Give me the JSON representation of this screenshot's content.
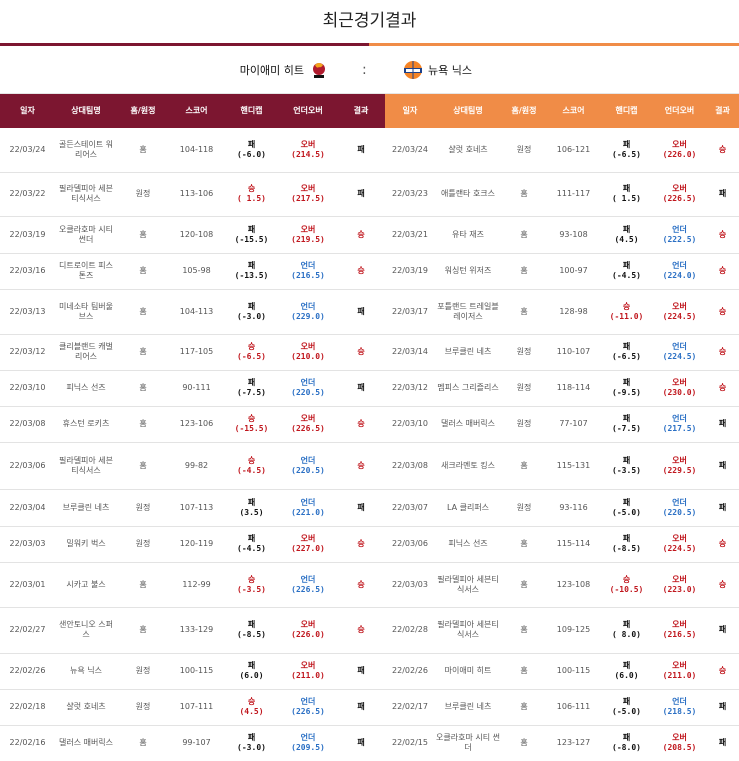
{
  "title": "최근경기결과",
  "left_team": "마이애미 히트",
  "right_team": "뉴욕 닉스",
  "vs": ":",
  "colors": {
    "left_header": "#7c1630",
    "right_header": "#f08c47",
    "win": "#c0161d",
    "under": "#2a6fc4"
  },
  "left_headers": [
    "일자",
    "상대팀명",
    "홈/원정",
    "스코어",
    "핸디캡",
    "언더오버",
    "결과"
  ],
  "right_headers": [
    "일자",
    "상대팀명",
    "홈/원정",
    "스코어",
    "핸디캡",
    "언더오버",
    "결과"
  ],
  "rows": [
    {
      "left": {
        "date": "22/03/24",
        "opp": "골든스테이트 워리어스",
        "ha": "홈",
        "score": "104-118",
        "hc1": "패",
        "hc2": "(-6.0)",
        "hc_win": false,
        "ou1": "오버",
        "ou2": "(214.5)",
        "ou_over": true,
        "res": "패",
        "res_win": false
      },
      "right": {
        "date": "22/03/24",
        "opp": "샬럿 호네츠",
        "ha": "원정",
        "score": "106-121",
        "hc1": "패",
        "hc2": "(-6.5)",
        "hc_win": false,
        "ou1": "오버",
        "ou2": "(226.0)",
        "ou_over": true,
        "res": "승",
        "res_win": true
      }
    },
    {
      "left": {
        "date": "22/03/22",
        "opp": "필라델피아 세븐티식서스",
        "ha": "원정",
        "score": "113-106",
        "hc1": "승",
        "hc2": "( 1.5)",
        "hc_win": true,
        "ou1": "오버",
        "ou2": "(217.5)",
        "ou_over": true,
        "res": "패",
        "res_win": false
      },
      "right": {
        "date": "22/03/23",
        "opp": "애틀랜타 호크스",
        "ha": "홈",
        "score": "111-117",
        "hc1": "패",
        "hc2": "( 1.5)",
        "hc_win": false,
        "ou1": "오버",
        "ou2": "(226.5)",
        "ou_over": true,
        "res": "패",
        "res_win": false
      }
    },
    {
      "left": {
        "date": "22/03/19",
        "opp": "오클라호마 시티 썬더",
        "ha": "홈",
        "score": "120-108",
        "hc1": "패",
        "hc2": "(-15.5)",
        "hc_win": false,
        "ou1": "오버",
        "ou2": "(219.5)",
        "ou_over": true,
        "res": "승",
        "res_win": true
      },
      "right": {
        "date": "22/03/21",
        "opp": "유타 재즈",
        "ha": "홈",
        "score": "93-108",
        "hc1": "패",
        "hc2": "(4.5)",
        "hc_win": false,
        "ou1": "언더",
        "ou2": "(222.5)",
        "ou_over": false,
        "res": "승",
        "res_win": true
      }
    },
    {
      "left": {
        "date": "22/03/16",
        "opp": "디트로이트 피스톤즈",
        "ha": "홈",
        "score": "105-98",
        "hc1": "패",
        "hc2": "(-13.5)",
        "hc_win": false,
        "ou1": "언더",
        "ou2": "(216.5)",
        "ou_over": false,
        "res": "승",
        "res_win": true
      },
      "right": {
        "date": "22/03/19",
        "opp": "워싱턴 위저즈",
        "ha": "홈",
        "score": "100-97",
        "hc1": "패",
        "hc2": "(-4.5)",
        "hc_win": false,
        "ou1": "언더",
        "ou2": "(224.0)",
        "ou_over": false,
        "res": "승",
        "res_win": true
      }
    },
    {
      "left": {
        "date": "22/03/13",
        "opp": "미네소타 팀버울브스",
        "ha": "홈",
        "score": "104-113",
        "hc1": "패",
        "hc2": "(-3.0)",
        "hc_win": false,
        "ou1": "언더",
        "ou2": "(229.0)",
        "ou_over": false,
        "res": "패",
        "res_win": false
      },
      "right": {
        "date": "22/03/17",
        "opp": "포틀랜드 트레일블레이저스",
        "ha": "홈",
        "score": "128-98",
        "hc1": "승",
        "hc2": "(-11.0)",
        "hc_win": true,
        "ou1": "오버",
        "ou2": "(224.5)",
        "ou_over": true,
        "res": "승",
        "res_win": true
      }
    },
    {
      "left": {
        "date": "22/03/12",
        "opp": "클리블랜드 캐벌리어스",
        "ha": "홈",
        "score": "117-105",
        "hc1": "승",
        "hc2": "(-6.5)",
        "hc_win": true,
        "ou1": "오버",
        "ou2": "(210.0)",
        "ou_over": true,
        "res": "승",
        "res_win": true
      },
      "right": {
        "date": "22/03/14",
        "opp": "브루클린 네츠",
        "ha": "원정",
        "score": "110-107",
        "hc1": "패",
        "hc2": "(-6.5)",
        "hc_win": false,
        "ou1": "언더",
        "ou2": "(224.5)",
        "ou_over": false,
        "res": "승",
        "res_win": true
      }
    },
    {
      "left": {
        "date": "22/03/10",
        "opp": "피닉스 선즈",
        "ha": "홈",
        "score": "90-111",
        "hc1": "패",
        "hc2": "(-7.5)",
        "hc_win": false,
        "ou1": "언더",
        "ou2": "(220.5)",
        "ou_over": false,
        "res": "패",
        "res_win": false
      },
      "right": {
        "date": "22/03/12",
        "opp": "멤피스 그리즐리스",
        "ha": "원정",
        "score": "118-114",
        "hc1": "패",
        "hc2": "(-9.5)",
        "hc_win": false,
        "ou1": "오버",
        "ou2": "(230.0)",
        "ou_over": true,
        "res": "승",
        "res_win": true
      }
    },
    {
      "left": {
        "date": "22/03/08",
        "opp": "휴스턴 로키츠",
        "ha": "홈",
        "score": "123-106",
        "hc1": "승",
        "hc2": "(-15.5)",
        "hc_win": true,
        "ou1": "오버",
        "ou2": "(226.5)",
        "ou_over": true,
        "res": "승",
        "res_win": true
      },
      "right": {
        "date": "22/03/10",
        "opp": "댈러스 매버릭스",
        "ha": "원정",
        "score": "77-107",
        "hc1": "패",
        "hc2": "(-7.5)",
        "hc_win": false,
        "ou1": "언더",
        "ou2": "(217.5)",
        "ou_over": false,
        "res": "패",
        "res_win": false
      }
    },
    {
      "left": {
        "date": "22/03/06",
        "opp": "필라델피아 세븐티식서스",
        "ha": "홈",
        "score": "99-82",
        "hc1": "승",
        "hc2": "(-4.5)",
        "hc_win": true,
        "ou1": "언더",
        "ou2": "(220.5)",
        "ou_over": false,
        "res": "승",
        "res_win": true
      },
      "right": {
        "date": "22/03/08",
        "opp": "새크라멘토 킹스",
        "ha": "홈",
        "score": "115-131",
        "hc1": "패",
        "hc2": "(-3.5)",
        "hc_win": false,
        "ou1": "오버",
        "ou2": "(229.5)",
        "ou_over": true,
        "res": "패",
        "res_win": false
      }
    },
    {
      "left": {
        "date": "22/03/04",
        "opp": "브루클린 네츠",
        "ha": "원정",
        "score": "107-113",
        "hc1": "패",
        "hc2": "(3.5)",
        "hc_win": false,
        "ou1": "언더",
        "ou2": "(221.0)",
        "ou_over": false,
        "res": "패",
        "res_win": false
      },
      "right": {
        "date": "22/03/07",
        "opp": "LA 클리퍼스",
        "ha": "원정",
        "score": "93-116",
        "hc1": "패",
        "hc2": "(-5.0)",
        "hc_win": false,
        "ou1": "언더",
        "ou2": "(220.5)",
        "ou_over": false,
        "res": "패",
        "res_win": false
      }
    },
    {
      "left": {
        "date": "22/03/03",
        "opp": "밀워키 벅스",
        "ha": "원정",
        "score": "120-119",
        "hc1": "패",
        "hc2": "(-4.5)",
        "hc_win": false,
        "ou1": "오버",
        "ou2": "(227.0)",
        "ou_over": true,
        "res": "승",
        "res_win": true
      },
      "right": {
        "date": "22/03/06",
        "opp": "피닉스 선즈",
        "ha": "홈",
        "score": "115-114",
        "hc1": "패",
        "hc2": "(-8.5)",
        "hc_win": false,
        "ou1": "오버",
        "ou2": "(224.5)",
        "ou_over": true,
        "res": "승",
        "res_win": true
      }
    },
    {
      "left": {
        "date": "22/03/01",
        "opp": "시카고 불스",
        "ha": "홈",
        "score": "112-99",
        "hc1": "승",
        "hc2": "(-3.5)",
        "hc_win": true,
        "ou1": "언더",
        "ou2": "(226.5)",
        "ou_over": false,
        "res": "승",
        "res_win": true
      },
      "right": {
        "date": "22/03/03",
        "opp": "필라델피아 세븐티식서스",
        "ha": "홈",
        "score": "123-108",
        "hc1": "승",
        "hc2": "(-10.5)",
        "hc_win": true,
        "ou1": "오버",
        "ou2": "(223.0)",
        "ou_over": true,
        "res": "승",
        "res_win": true
      }
    },
    {
      "left": {
        "date": "22/02/27",
        "opp": "샌안토니오 스퍼스",
        "ha": "홈",
        "score": "133-129",
        "hc1": "패",
        "hc2": "(-8.5)",
        "hc_win": false,
        "ou1": "오버",
        "ou2": "(226.0)",
        "ou_over": true,
        "res": "승",
        "res_win": true
      },
      "right": {
        "date": "22/02/28",
        "opp": "필라델피아 세븐티식서스",
        "ha": "홈",
        "score": "109-125",
        "hc1": "패",
        "hc2": "( 8.0)",
        "hc_win": false,
        "ou1": "오버",
        "ou2": "(216.5)",
        "ou_over": true,
        "res": "패",
        "res_win": false
      }
    },
    {
      "left": {
        "date": "22/02/26",
        "opp": "뉴욕 닉스",
        "ha": "원정",
        "score": "100-115",
        "hc1": "패",
        "hc2": "(6.0)",
        "hc_win": false,
        "ou1": "오버",
        "ou2": "(211.0)",
        "ou_over": true,
        "res": "패",
        "res_win": false
      },
      "right": {
        "date": "22/02/26",
        "opp": "마이애미 히트",
        "ha": "홈",
        "score": "100-115",
        "hc1": "패",
        "hc2": "(6.0)",
        "hc_win": false,
        "ou1": "오버",
        "ou2": "(211.0)",
        "ou_over": true,
        "res": "승",
        "res_win": true
      }
    },
    {
      "left": {
        "date": "22/02/18",
        "opp": "샬럿 호네츠",
        "ha": "원정",
        "score": "107-111",
        "hc1": "승",
        "hc2": "(4.5)",
        "hc_win": true,
        "ou1": "언더",
        "ou2": "(226.5)",
        "ou_over": false,
        "res": "패",
        "res_win": false
      },
      "right": {
        "date": "22/02/17",
        "opp": "브루클린 네츠",
        "ha": "홈",
        "score": "106-111",
        "hc1": "패",
        "hc2": "(-5.0)",
        "hc_win": false,
        "ou1": "언더",
        "ou2": "(218.5)",
        "ou_over": false,
        "res": "패",
        "res_win": false
      }
    },
    {
      "left": {
        "date": "22/02/16",
        "opp": "댈러스 매버릭스",
        "ha": "홈",
        "score": "99-107",
        "hc1": "패",
        "hc2": "(-3.0)",
        "hc_win": false,
        "ou1": "언더",
        "ou2": "(209.5)",
        "ou_over": false,
        "res": "패",
        "res_win": false
      },
      "right": {
        "date": "22/02/15",
        "opp": "오클라호마 시티 썬더",
        "ha": "홈",
        "score": "123-127",
        "hc1": "패",
        "hc2": "(-8.0)",
        "hc_win": false,
        "ou1": "오버",
        "ou2": "(208.5)",
        "ou_over": true,
        "res": "패",
        "res_win": false
      }
    }
  ]
}
